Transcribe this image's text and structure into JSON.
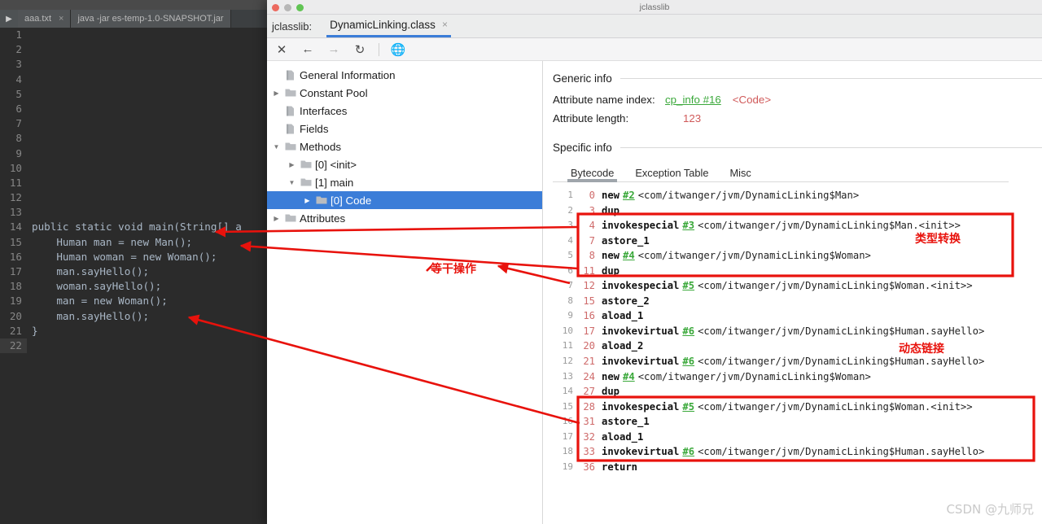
{
  "ide": {
    "tabs": [
      {
        "label": "aaa.txt",
        "close": "×"
      },
      {
        "label": "java  -jar es-temp-1.0-SNAPSHOT.jar",
        "close": ""
      }
    ],
    "run_icon": "▶",
    "editor_lines": [
      {
        "n": "1",
        "text": ""
      },
      {
        "n": "2",
        "text": ""
      },
      {
        "n": "3",
        "text": ""
      },
      {
        "n": "4",
        "text": ""
      },
      {
        "n": "5",
        "text": ""
      },
      {
        "n": "6",
        "text": ""
      },
      {
        "n": "7",
        "text": ""
      },
      {
        "n": "8",
        "text": ""
      },
      {
        "n": "9",
        "text": ""
      },
      {
        "n": "10",
        "text": ""
      },
      {
        "n": "11",
        "text": ""
      },
      {
        "n": "12",
        "text": ""
      },
      {
        "n": "13",
        "text": ""
      },
      {
        "n": "14",
        "text": "public static void main(String[] a"
      },
      {
        "n": "15",
        "text": "    Human man = new Man();"
      },
      {
        "n": "16",
        "text": "    Human woman = new Woman();"
      },
      {
        "n": "17",
        "text": "    man.sayHello();"
      },
      {
        "n": "18",
        "text": "    woman.sayHello();"
      },
      {
        "n": "19",
        "text": "    man = new Woman();"
      },
      {
        "n": "20",
        "text": "    man.sayHello();"
      },
      {
        "n": "21",
        "text": "}"
      },
      {
        "n": "22",
        "text": ""
      }
    ]
  },
  "jclasslib": {
    "window_title": "jclasslib",
    "app_label": "jclasslib:",
    "file_tab": "DynamicLinking.class",
    "file_tab_close": "×",
    "toolbar": [
      {
        "name": "close-icon",
        "glyph": "✕",
        "dim": false
      },
      {
        "name": "back-icon",
        "glyph": "←",
        "dim": false
      },
      {
        "name": "forward-icon",
        "glyph": "→",
        "dim": true
      },
      {
        "name": "reload-icon",
        "glyph": "↻",
        "dim": false
      },
      {
        "name": "browse-icon",
        "glyph": "ἱ0",
        "dim": true
      }
    ],
    "tree": [
      {
        "label": "General Information",
        "indent": 0,
        "twisty": "",
        "icon": "file",
        "selected": false
      },
      {
        "label": "Constant Pool",
        "indent": 0,
        "twisty": "▶",
        "icon": "folder",
        "selected": false
      },
      {
        "label": "Interfaces",
        "indent": 0,
        "twisty": "",
        "icon": "file",
        "selected": false
      },
      {
        "label": "Fields",
        "indent": 0,
        "twisty": "",
        "icon": "file",
        "selected": false
      },
      {
        "label": "Methods",
        "indent": 0,
        "twisty": "▼",
        "icon": "folder",
        "selected": false
      },
      {
        "label": "[0] <init>",
        "indent": 1,
        "twisty": "▶",
        "icon": "folder",
        "selected": false
      },
      {
        "label": "[1] main",
        "indent": 1,
        "twisty": "▼",
        "icon": "folder",
        "selected": false
      },
      {
        "label": "[0] Code",
        "indent": 2,
        "twisty": "▶",
        "icon": "folder",
        "selected": true
      },
      {
        "label": "Attributes",
        "indent": 0,
        "twisty": "▶",
        "icon": "folder",
        "selected": false
      }
    ],
    "generic_info_heading": "Generic info",
    "specific_info_heading": "Specific info",
    "attr_name_index_label": "Attribute name index:",
    "attr_name_index_link": "cp_info #16",
    "attr_name_index_value": "<Code>",
    "attr_length_label": "Attribute length:",
    "attr_length_value": "123",
    "bytecode_tabs": [
      {
        "label": "Bytecode",
        "active": true
      },
      {
        "label": "Exception Table",
        "active": false
      },
      {
        "label": "Misc",
        "active": false
      }
    ],
    "bytecode": [
      {
        "n": "1",
        "offset": "0",
        "mnemonic": "new",
        "cp": "#2",
        "desc": "<com/itwanger/jvm/DynamicLinking$Man>"
      },
      {
        "n": "2",
        "offset": "3",
        "mnemonic": "dup",
        "cp": "",
        "desc": ""
      },
      {
        "n": "3",
        "offset": "4",
        "mnemonic": "invokespecial",
        "cp": "#3",
        "desc": "<com/itwanger/jvm/DynamicLinking$Man.<init>>"
      },
      {
        "n": "4",
        "offset": "7",
        "mnemonic": "astore_1",
        "cp": "",
        "desc": ""
      },
      {
        "n": "5",
        "offset": "8",
        "mnemonic": "new",
        "cp": "#4",
        "desc": "<com/itwanger/jvm/DynamicLinking$Woman>"
      },
      {
        "n": "6",
        "offset": "11",
        "mnemonic": "dup",
        "cp": "",
        "desc": ""
      },
      {
        "n": "7",
        "offset": "12",
        "mnemonic": "invokespecial",
        "cp": "#5",
        "desc": "<com/itwanger/jvm/DynamicLinking$Woman.<init>>"
      },
      {
        "n": "8",
        "offset": "15",
        "mnemonic": "astore_2",
        "cp": "",
        "desc": ""
      },
      {
        "n": "9",
        "offset": "16",
        "mnemonic": "aload_1",
        "cp": "",
        "desc": ""
      },
      {
        "n": "10",
        "offset": "17",
        "mnemonic": "invokevirtual",
        "cp": "#6",
        "desc": "<com/itwanger/jvm/DynamicLinking$Human.sayHello>"
      },
      {
        "n": "11",
        "offset": "20",
        "mnemonic": "aload_2",
        "cp": "",
        "desc": ""
      },
      {
        "n": "12",
        "offset": "21",
        "mnemonic": "invokevirtual",
        "cp": "#6",
        "desc": "<com/itwanger/jvm/DynamicLinking$Human.sayHello>"
      },
      {
        "n": "13",
        "offset": "24",
        "mnemonic": "new",
        "cp": "#4",
        "desc": "<com/itwanger/jvm/DynamicLinking$Woman>"
      },
      {
        "n": "14",
        "offset": "27",
        "mnemonic": "dup",
        "cp": "",
        "desc": ""
      },
      {
        "n": "15",
        "offset": "28",
        "mnemonic": "invokespecial",
        "cp": "#5",
        "desc": "<com/itwanger/jvm/DynamicLinking$Woman.<init>>"
      },
      {
        "n": "16",
        "offset": "31",
        "mnemonic": "astore_1",
        "cp": "",
        "desc": ""
      },
      {
        "n": "17",
        "offset": "32",
        "mnemonic": "aload_1",
        "cp": "",
        "desc": ""
      },
      {
        "n": "18",
        "offset": "33",
        "mnemonic": "invokevirtual",
        "cp": "#6",
        "desc": "<com/itwanger/jvm/DynamicLinking$Human.sayHello>"
      },
      {
        "n": "19",
        "offset": "36",
        "mnemonic": "return",
        "cp": "",
        "desc": ""
      }
    ]
  },
  "annotations": {
    "accent_color": "#e8120c",
    "note_type_cast": "类型转换",
    "note_operations": "等干操作",
    "note_dynamic_link": "动态链接"
  },
  "watermark": "CSDN @九师兄"
}
